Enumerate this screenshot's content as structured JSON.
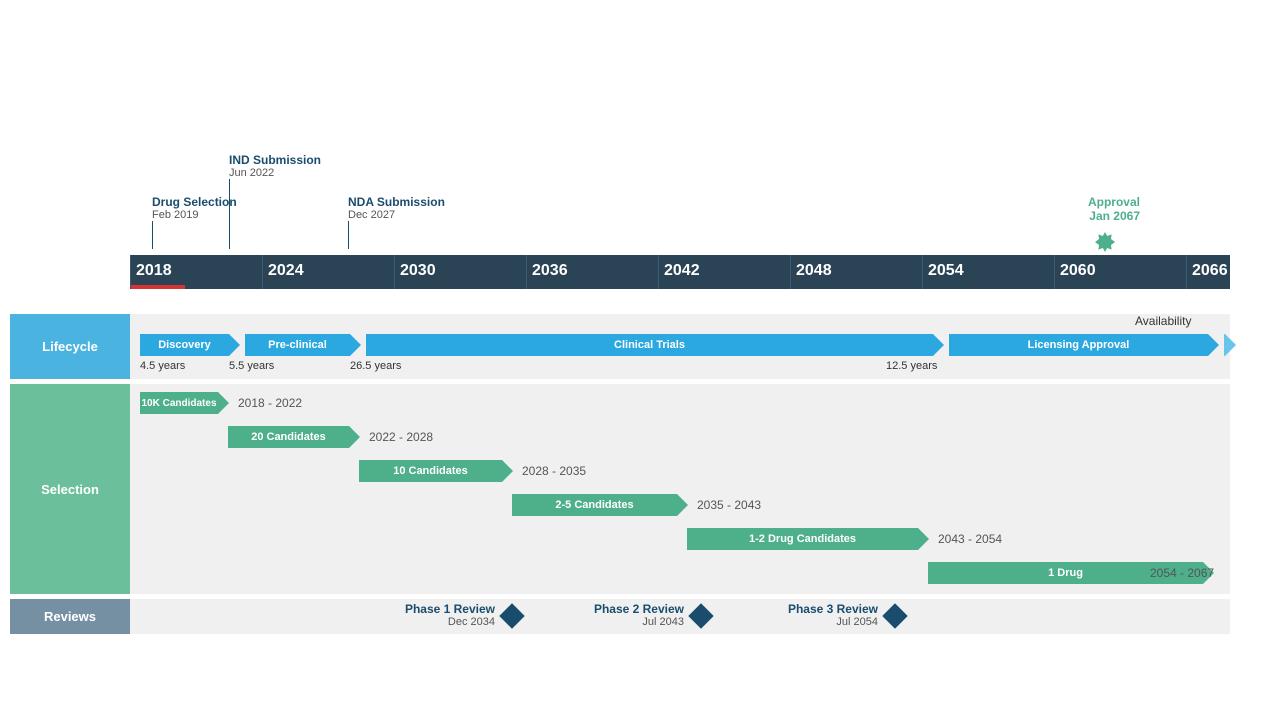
{
  "chart_data": {
    "type": "timeline",
    "title": "",
    "x_axis_years": [
      2018,
      2024,
      2030,
      2036,
      2042,
      2048,
      2054,
      2060,
      2066
    ],
    "x_range": [
      2018,
      2068
    ],
    "milestones": [
      {
        "name": "Drug Selection",
        "date": "Feb 2019",
        "x": 2019
      },
      {
        "name": "IND Submission",
        "date": "Jun 2022",
        "x": 2022.5
      },
      {
        "name": "NDA Submission",
        "date": "Dec 2027",
        "x": 2027.9
      }
    ],
    "approval": {
      "name": "Approval",
      "date": "Jan 2067",
      "x": 2067
    },
    "progress_to": 2020.5,
    "lifecycle": [
      {
        "name": "Discovery",
        "start": 2018,
        "end": 2022.5,
        "duration": "4.5 years"
      },
      {
        "name": "Pre-clinical",
        "start": 2022.5,
        "end": 2028,
        "duration": "5.5 years"
      },
      {
        "name": "Clinical Trials",
        "start": 2028,
        "end": 2054.5,
        "duration": "26.5 years"
      },
      {
        "name": "Licensing Approval",
        "start": 2054.5,
        "end": 2067,
        "duration": "12.5 years"
      },
      {
        "name": "Availability",
        "start": 2067,
        "end": 2068,
        "duration": ""
      }
    ],
    "selection": [
      {
        "name": "10K Candidates",
        "start": 2018,
        "end": 2022,
        "label": "2018 - 2022"
      },
      {
        "name": "20 Candidates",
        "start": 2022,
        "end": 2028,
        "label": "2022 - 2028"
      },
      {
        "name": "10 Candidates",
        "start": 2028,
        "end": 2035,
        "label": "2028 - 2035"
      },
      {
        "name": "2-5 Candidates",
        "start": 2035,
        "end": 2043,
        "label": "2035 - 2043"
      },
      {
        "name": "1-2 Drug Candidates",
        "start": 2043,
        "end": 2054,
        "label": "2043 - 2054"
      },
      {
        "name": "1 Drug",
        "start": 2054,
        "end": 2067,
        "label": "2054 - 2067"
      }
    ],
    "reviews": [
      {
        "name": "Phase 1 Review",
        "date": "Dec 2034",
        "x": 2034.9
      },
      {
        "name": "Phase 2 Review",
        "date": "Jul 2043",
        "x": 2043.5
      },
      {
        "name": "Phase 3 Review",
        "date": "Jul 2054",
        "x": 2054.5
      }
    ]
  },
  "labels": {
    "lifecycle": "Lifecycle",
    "selection": "Selection",
    "reviews": "Reviews"
  }
}
